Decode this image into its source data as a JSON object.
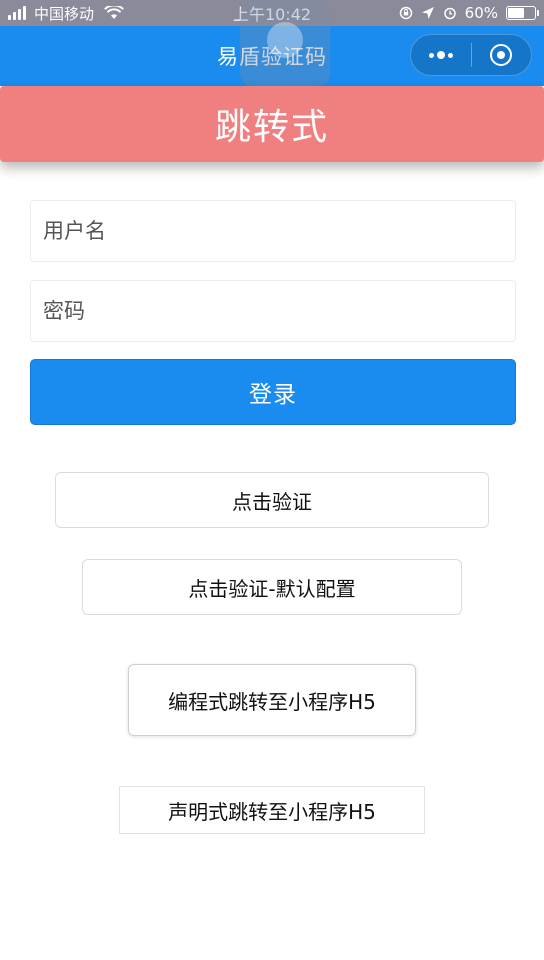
{
  "status_bar": {
    "carrier": "中国移动",
    "time": "上午10:42",
    "battery": "60%",
    "battery_level": 0.6,
    "icons": [
      "signal-icon",
      "wifi-icon",
      "rotation-lock-icon",
      "location-icon",
      "alarm-icon",
      "battery-icon"
    ]
  },
  "nav": {
    "title": "易盾验证码",
    "capsule": {
      "more_icon": "more-dots-icon",
      "close_icon": "target-circle-icon"
    }
  },
  "banner": {
    "title": "跳转式"
  },
  "form": {
    "username_placeholder": "用户名",
    "password_placeholder": "密码",
    "login_label": "登录"
  },
  "buttons": {
    "click_verify": "点击验证",
    "click_verify_default": "点击验证-默认配置",
    "programmatic_jump": "编程式跳转至小程序H5",
    "declarative_jump": "声明式跳转至小程序H5"
  },
  "colors": {
    "primary": "#1a8cf0",
    "banner": "#f08080",
    "status_bar": "#8a8a9a"
  }
}
